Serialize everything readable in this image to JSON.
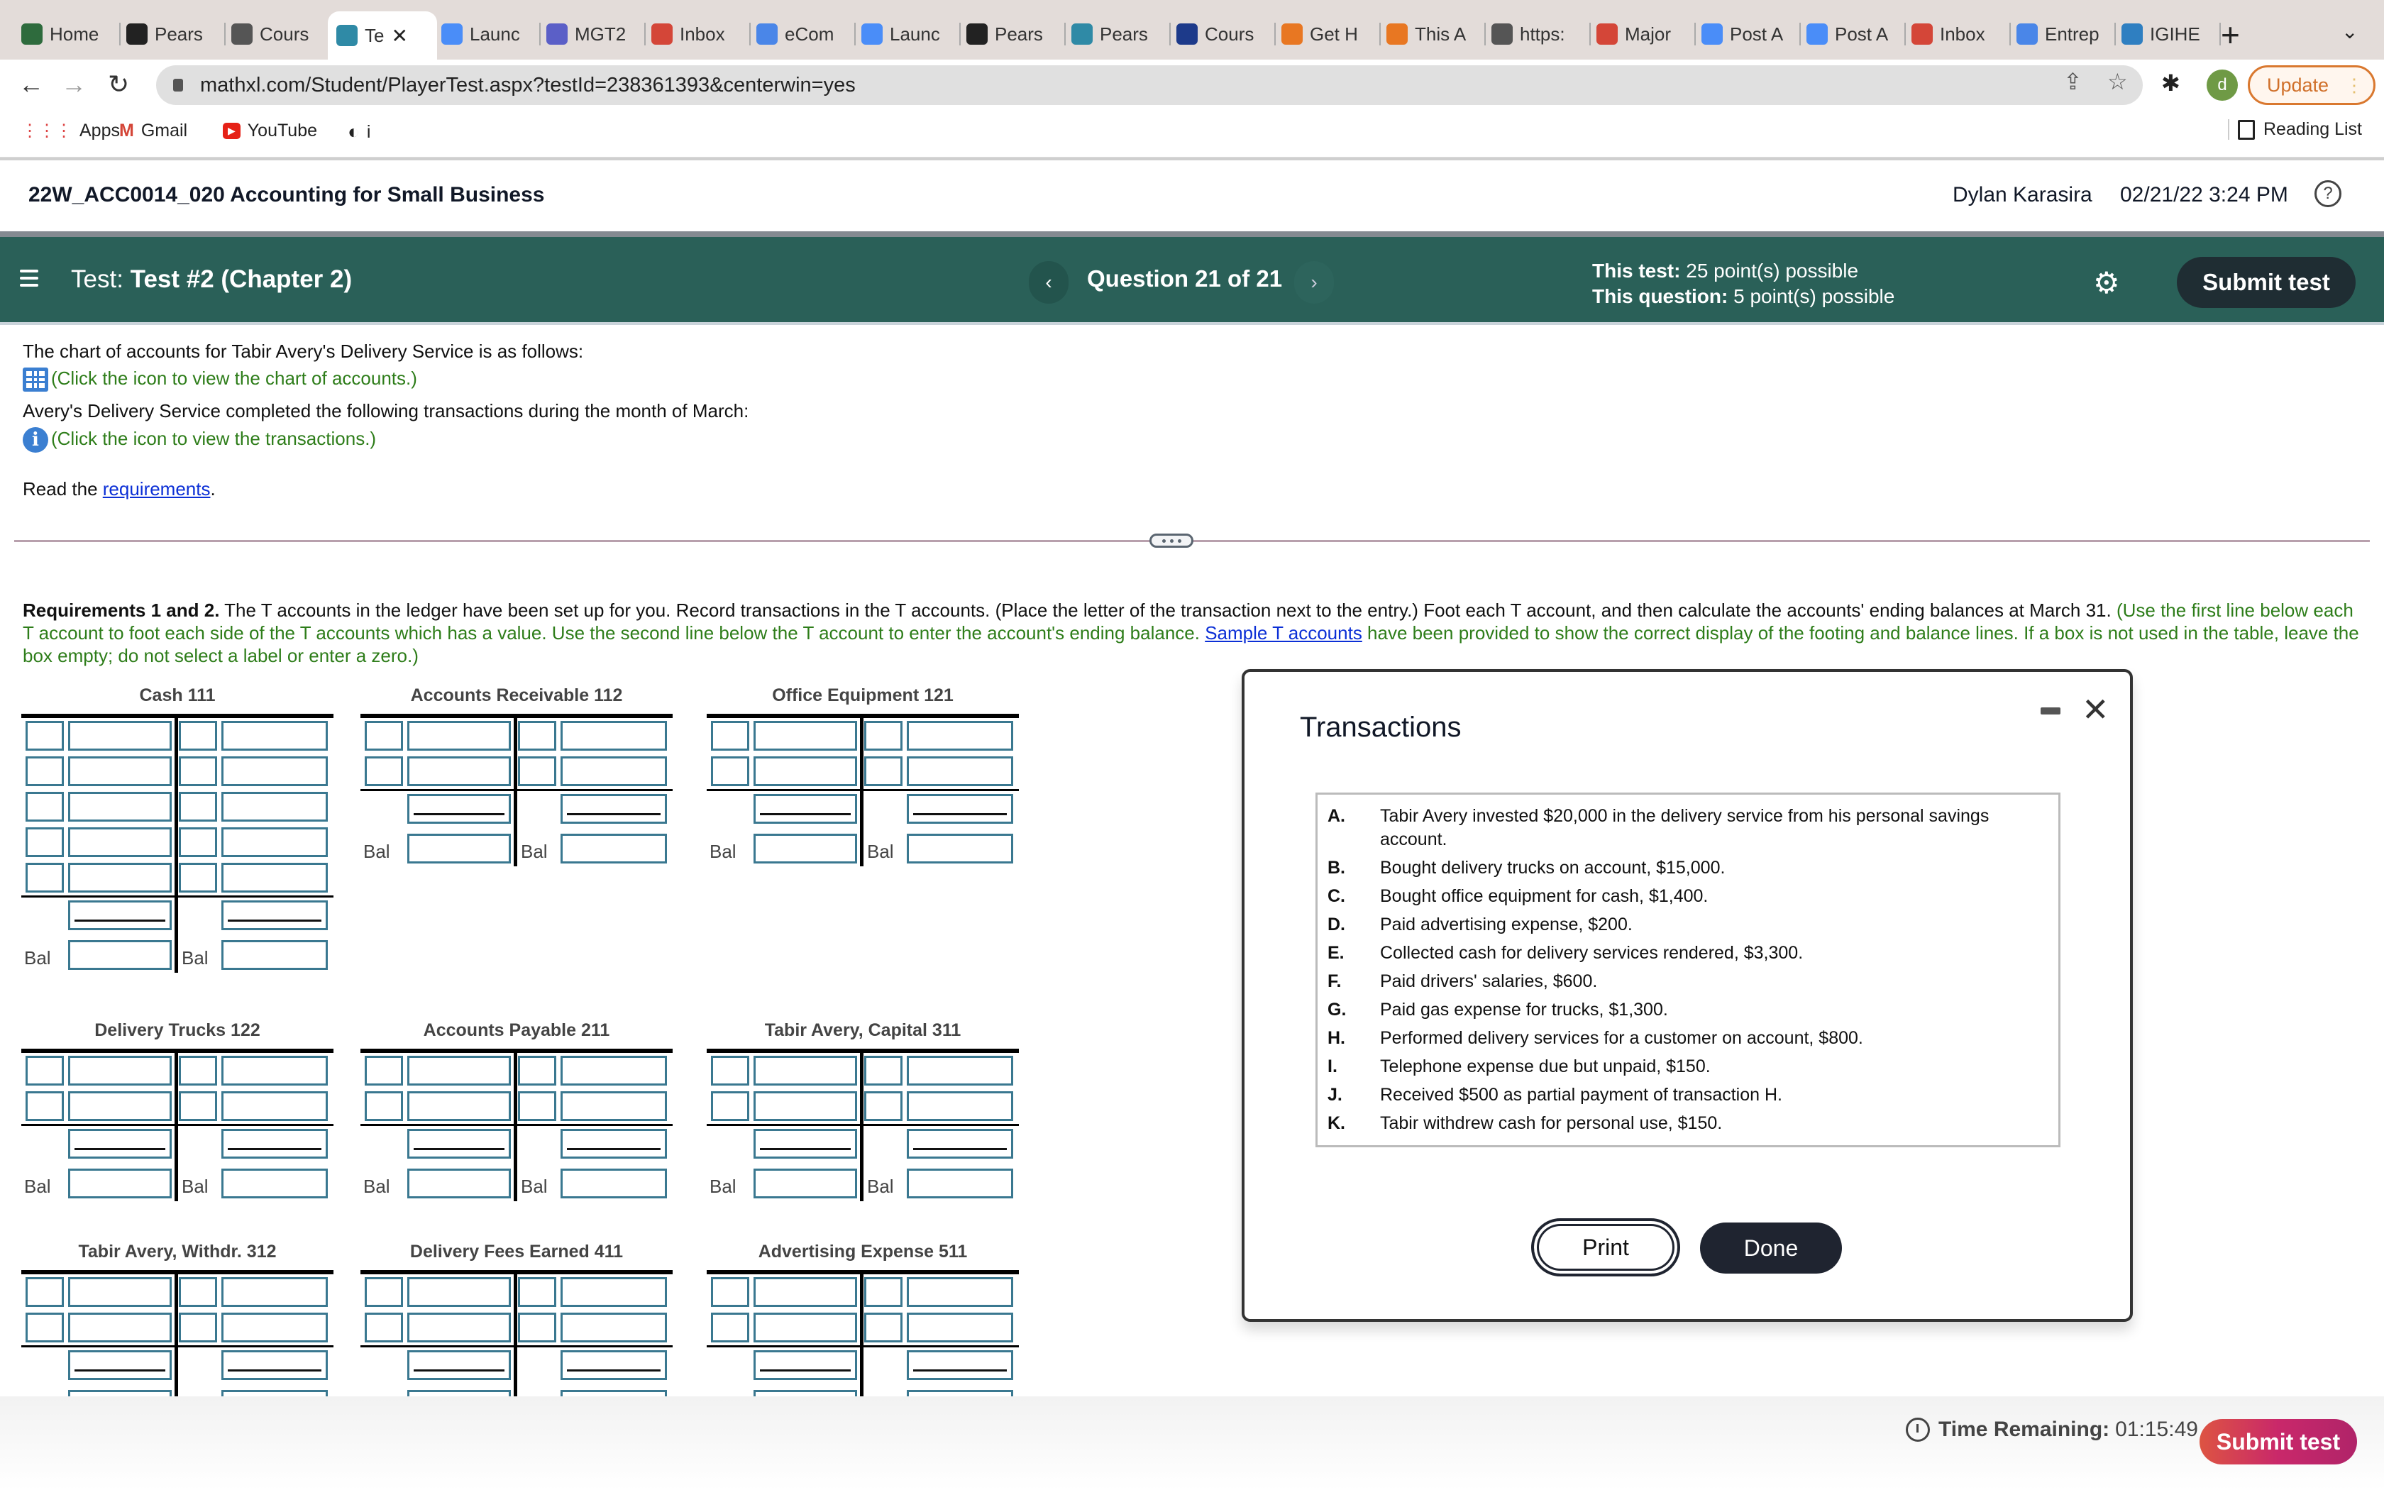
{
  "browser": {
    "tabs": [
      {
        "label": "Home",
        "icon": "ac-icon",
        "color": "#2e6b3d"
      },
      {
        "label": "Pears",
        "icon": "pearson-icon",
        "color": "#222222"
      },
      {
        "label": "Cours",
        "icon": "doc-icon",
        "color": "#555555"
      },
      {
        "label": "Te",
        "icon": "pearson-p-icon",
        "color": "#2f8aa6",
        "active": true
      },
      {
        "label": "Launc",
        "icon": "zoom-icon",
        "color": "#4a8df8"
      },
      {
        "label": "MGT2",
        "icon": "teams-icon",
        "color": "#5b5fc7"
      },
      {
        "label": "Inbox",
        "icon": "gmail-icon",
        "color": "#d44638"
      },
      {
        "label": "eCom",
        "icon": "docs-icon",
        "color": "#4a86e8"
      },
      {
        "label": "Launc",
        "icon": "zoom-icon",
        "color": "#4a8df8"
      },
      {
        "label": "Pears",
        "icon": "pearson-icon",
        "color": "#222222"
      },
      {
        "label": "Pears",
        "icon": "pearson-p-icon",
        "color": "#2f8aa6"
      },
      {
        "label": "Cours",
        "icon": "star-shield-icon",
        "color": "#1d3a8a"
      },
      {
        "label": "Get H",
        "icon": "chegg-icon",
        "color": "#e87722"
      },
      {
        "label": "This A",
        "icon": "chegg-icon",
        "color": "#e87722"
      },
      {
        "label": "https:",
        "icon": "doc-icon",
        "color": "#555555"
      },
      {
        "label": "Major",
        "icon": "gmail-icon",
        "color": "#d44638"
      },
      {
        "label": "Post A",
        "icon": "zoom-icon",
        "color": "#4a8df8"
      },
      {
        "label": "Post A",
        "icon": "zoom-icon",
        "color": "#4a8df8"
      },
      {
        "label": "Inbox",
        "icon": "gmail-icon",
        "color": "#d44638"
      },
      {
        "label": "Entrep",
        "icon": "docs-icon",
        "color": "#4a86e8"
      },
      {
        "label": "IGIHE",
        "icon": "igihe-icon",
        "color": "#2f7fc1"
      }
    ],
    "url": "mathxl.com/Student/PlayerTest.aspx?testId=238361393&centerwin=yes",
    "profile_initial": "d",
    "update_label": "Update",
    "bookmarks": [
      {
        "label": "Apps",
        "icon": "apps-grid-icon"
      },
      {
        "label": "Gmail",
        "icon": "gmail-icon"
      },
      {
        "label": "YouTube",
        "icon": "youtube-icon"
      },
      {
        "label": "i",
        "icon": "pearson-icon"
      }
    ],
    "reading_list_label": "Reading List"
  },
  "header": {
    "course_title": "22W_ACC0014_020 Accounting for Small Business",
    "user_name": "Dylan Karasira",
    "datetime": "02/21/22 3:24 PM"
  },
  "test_bar": {
    "test_prefix": "Test:",
    "test_name": "Test #2 (Chapter 2)",
    "question_label": "Question 21 of 21",
    "this_test_label": "This test:",
    "this_test_value": "25 point(s) possible",
    "this_question_label": "This question:",
    "this_question_value": "5 point(s) possible",
    "submit_label": "Submit test"
  },
  "question": {
    "intro_line": "The chart of accounts for Tabir Avery's Delivery Service is as follows:",
    "chart_link": "(Click the icon to view the chart of accounts.)",
    "transactions_line": "Avery's Delivery Service completed the following transactions during the month of March:",
    "transactions_link": "(Click the icon to view the transactions.)",
    "read_prefix": "Read the ",
    "requirements_link": "requirements",
    "read_suffix": ".",
    "req_bold": "Requirements 1 and 2.",
    "req_text": " The T accounts in the ledger have been set up for you. Record transactions in the T accounts. (Place the letter of the transaction next to the entry.) Foot each T account, and then calculate the accounts' ending balances at March 31. ",
    "req_green_1": "(Use the first line below each T account to foot each side of the T accounts which has a value. Use the second line below the T account to enter the account's ending balance. ",
    "sample_link": "Sample T accounts",
    "req_green_2": " have been provided to show the correct display of the footing and balance lines. If a box is not used in the table, leave the box empty; do not select a label or enter a zero.)"
  },
  "t_accounts": [
    {
      "title": "Cash 111",
      "entry_rows": 5
    },
    {
      "title": "Accounts Receivable 112",
      "entry_rows": 2
    },
    {
      "title": "Office Equipment 121",
      "entry_rows": 2
    },
    {
      "title": "Delivery Trucks 122",
      "entry_rows": 2
    },
    {
      "title": "Accounts Payable 211",
      "entry_rows": 2
    },
    {
      "title": "Tabir Avery, Capital 311",
      "entry_rows": 2
    },
    {
      "title": "Tabir Avery, Withdr. 312",
      "entry_rows": 2
    },
    {
      "title": "Delivery Fees Earned 411",
      "entry_rows": 2
    },
    {
      "title": "Advertising Expense 511",
      "entry_rows": 2
    }
  ],
  "bal_label": "Bal",
  "dialog": {
    "title": "Transactions",
    "transactions": [
      {
        "letter": "A.",
        "text": "Tabir Avery invested $20,000 in the delivery service from his personal savings account."
      },
      {
        "letter": "B.",
        "text": "Bought delivery trucks on account, $15,000."
      },
      {
        "letter": "C.",
        "text": "Bought office equipment for cash, $1,400."
      },
      {
        "letter": "D.",
        "text": "Paid advertising expense, $200."
      },
      {
        "letter": "E.",
        "text": "Collected cash for delivery services rendered, $3,300."
      },
      {
        "letter": "F.",
        "text": "Paid drivers' salaries, $600."
      },
      {
        "letter": "G.",
        "text": "Paid gas expense for trucks, $1,300."
      },
      {
        "letter": "H.",
        "text": "Performed delivery services for a customer on account, $800."
      },
      {
        "letter": "I.",
        "text": "Telephone expense due but unpaid, $150."
      },
      {
        "letter": "J.",
        "text": "Received $500 as partial payment of transaction H."
      },
      {
        "letter": "K.",
        "text": "Tabir withdrew cash for personal use, $150."
      }
    ],
    "print_label": "Print",
    "done_label": "Done"
  },
  "footer": {
    "time_label": "Time Remaining:",
    "time_value": "01:15:49",
    "submit_label": "Submit test"
  }
}
